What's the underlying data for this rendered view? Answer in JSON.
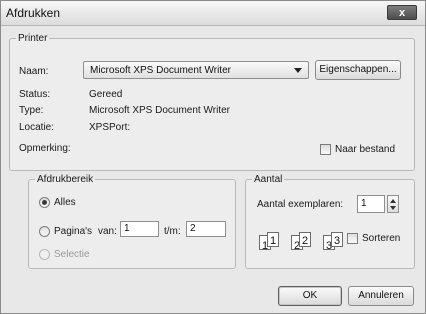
{
  "window": {
    "title": "Afdrukken",
    "close_label": "x"
  },
  "printer": {
    "legend": "Printer",
    "name_label": "Naam:",
    "name_value": "Microsoft XPS Document Writer",
    "properties_button": "Eigenschappen...",
    "status_label": "Status:",
    "status_value": "Gereed",
    "type_label": "Type:",
    "type_value": "Microsoft XPS Document Writer",
    "location_label": "Locatie:",
    "location_value": "XPSPort:",
    "comment_label": "Opmerking:",
    "print_to_file_label": "Naar bestand"
  },
  "range": {
    "legend": "Afdrukbereik",
    "all_label": "Alles",
    "pages_label": "Pagina's",
    "from_label": "van:",
    "from_value": "1",
    "to_label": "t/m:",
    "to_value": "2",
    "selection_label": "Selectie"
  },
  "copies": {
    "legend": "Aantal",
    "count_label": "Aantal exemplaren:",
    "count_value": "1",
    "collate_label": "Sorteren",
    "page_numbers": [
      "1",
      "1",
      "2",
      "2",
      "3",
      "3"
    ]
  },
  "buttons": {
    "ok": "OK",
    "cancel": "Annuleren"
  },
  "state": {
    "selected_range": "Alles",
    "print_to_file": false,
    "collate": false
  }
}
